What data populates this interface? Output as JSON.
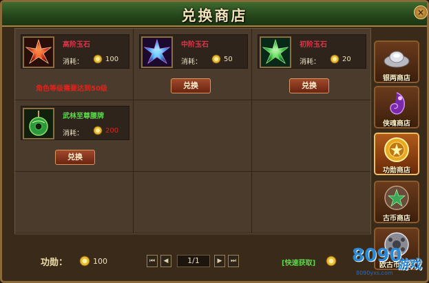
{
  "window": {
    "title": "兑换商店",
    "close_glyph": "×"
  },
  "items": [
    {
      "name": "高阶玉石",
      "name_color": "#e0344a",
      "cost_label": "消耗：",
      "cost": "100",
      "cost_color": "#f0e2c0",
      "icon": "red-star-gem-icon",
      "requirement": "角色等级需要达到50级"
    },
    {
      "name": "中阶玉石",
      "name_color": "#e0344a",
      "cost_label": "消耗：",
      "cost": "50",
      "cost_color": "#f0e2c0",
      "icon": "blue-star-gem-icon",
      "button": "兑换"
    },
    {
      "name": "初阶玉石",
      "name_color": "#e0344a",
      "cost_label": "消耗：",
      "cost": "20",
      "cost_color": "#f0e2c0",
      "icon": "green-star-gem-icon",
      "button": "兑换"
    },
    {
      "name": "武林至尊腰牌",
      "name_color": "#5bd84a",
      "cost_label": "消耗：",
      "cost": "200",
      "cost_color": "#e0231c",
      "icon": "jade-pendant-icon",
      "button": "兑换"
    }
  ],
  "sidebar": {
    "tabs": [
      {
        "label": "银两商店",
        "icon": "silver-ingot-icon",
        "active": false
      },
      {
        "label": "侠魂商店",
        "icon": "purple-soul-icon",
        "active": false
      },
      {
        "label": "功勋商店",
        "icon": "merit-medal-icon",
        "active": true
      },
      {
        "label": "古币商店",
        "icon": "ancient-coin-icon",
        "active": false
      },
      {
        "label": "欧古币商店",
        "icon": "silver-orb-icon",
        "active": false
      }
    ]
  },
  "footer": {
    "merit_label": "功勋：",
    "merit_value": "100",
    "page": "1/1",
    "first_glyph": "⏮",
    "prev_glyph": "◀",
    "next_glyph": "▶",
    "last_glyph": "⏭",
    "quick_link": "[快速获取]"
  },
  "watermark": {
    "brand": "8090",
    "site": "8090yxs.com",
    "tagline": "游戏"
  }
}
